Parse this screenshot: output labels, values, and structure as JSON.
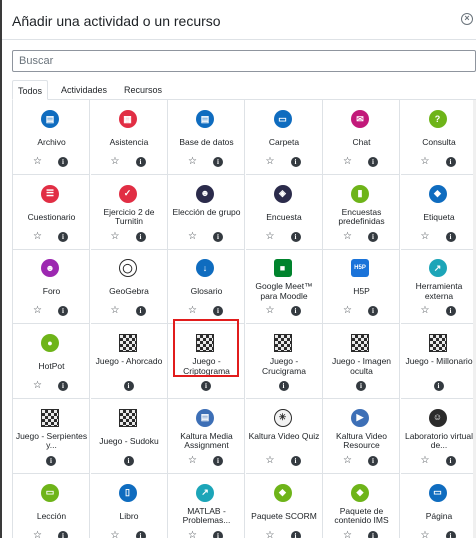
{
  "modal": {
    "title": "Añadir una actividad o un recurso",
    "close_label": "×"
  },
  "search": {
    "placeholder": "Buscar",
    "value": ""
  },
  "tabs": [
    {
      "label": "Todos",
      "active": true
    },
    {
      "label": "Actividades",
      "active": false
    },
    {
      "label": "Recursos",
      "active": false
    }
  ],
  "icons": {
    "star": "☆",
    "info": "i"
  },
  "items": [
    {
      "name": "Archivo",
      "icon": "file-icon",
      "color": "#0f6cbf",
      "glyph": "▤",
      "starred": true
    },
    {
      "name": "Asistencia",
      "icon": "attendance-icon",
      "color": "#e12e44",
      "glyph": "▦",
      "starred": true
    },
    {
      "name": "Base de datos",
      "icon": "database-icon",
      "color": "#0f6cbf",
      "glyph": "▤",
      "starred": true
    },
    {
      "name": "Carpeta",
      "icon": "folder-icon",
      "color": "#0f6cbf",
      "glyph": "▭",
      "starred": true
    },
    {
      "name": "Chat",
      "icon": "chat-icon",
      "color": "#c2197a",
      "glyph": "✉",
      "starred": true
    },
    {
      "name": "Consulta",
      "icon": "question-icon",
      "color": "#6eb419",
      "glyph": "?",
      "starred": true
    },
    {
      "name": "Cuestionario",
      "icon": "quiz-icon",
      "color": "#e12e44",
      "glyph": "☰",
      "starred": true
    },
    {
      "name": "Ejercicio 2 de Turnitin",
      "icon": "turnitin-icon",
      "color": "#e12e44",
      "glyph": "✓",
      "starred": true
    },
    {
      "name": "Elección de grupo",
      "icon": "group-choice-icon",
      "color": "#2b2b4b",
      "glyph": "☻",
      "starred": true
    },
    {
      "name": "Encuesta",
      "icon": "survey-icon",
      "color": "#2b2b4b",
      "glyph": "◈",
      "starred": true
    },
    {
      "name": "Encuestas predefinidas",
      "icon": "feedback-icon",
      "color": "#6eb419",
      "glyph": "▮",
      "starred": true
    },
    {
      "name": "Etiqueta",
      "icon": "label-icon",
      "color": "#0f6cbf",
      "glyph": "◆",
      "starred": true
    },
    {
      "name": "Foro",
      "icon": "forum-icon",
      "color": "#9c27b0",
      "glyph": "☻",
      "starred": true
    },
    {
      "name": "GeoGebra",
      "icon": "geogebra-icon",
      "color": "#ffffff",
      "glyph": "◯",
      "starred": true
    },
    {
      "name": "Glosario",
      "icon": "glossary-icon",
      "color": "#0f6cbf",
      "glyph": "↓",
      "starred": true
    },
    {
      "name": "Google Meet™ para Moodle",
      "icon": "google-meet-icon",
      "color": "#00832d",
      "glyph": "■",
      "starred": true
    },
    {
      "name": "H5P",
      "icon": "h5p-icon",
      "color": "#1a73d9",
      "glyph": "H5P",
      "starred": true
    },
    {
      "name": "Herramienta externa",
      "icon": "external-tool-icon",
      "color": "#1ca5b8",
      "glyph": "↗",
      "starred": true
    },
    {
      "name": "HotPot",
      "icon": "hotpot-icon",
      "color": "#6eb419",
      "glyph": "●",
      "starred": true
    },
    {
      "name": "Juego - Ahorcado",
      "icon": "game-hangman-icon",
      "color": "#2b2b2b",
      "glyph": "",
      "starred": false
    },
    {
      "name": "Juego - Criptograma",
      "icon": "game-cryptex-icon",
      "color": "#2b2b2b",
      "glyph": "",
      "starred": false
    },
    {
      "name": "Juego - Crucigrama",
      "icon": "game-crossword-icon",
      "color": "#2b2b2b",
      "glyph": "",
      "starred": false
    },
    {
      "name": "Juego - Imagen oculta",
      "icon": "game-hidden-picture-icon",
      "color": "#2b2b2b",
      "glyph": "",
      "starred": false
    },
    {
      "name": "Juego - Millonario",
      "icon": "game-millionaire-icon",
      "color": "#2b2b2b",
      "glyph": "",
      "starred": false
    },
    {
      "name": "Juego - Serpientes y...",
      "icon": "game-snakes-icon",
      "color": "#2b2b2b",
      "glyph": "",
      "starred": false
    },
    {
      "name": "Juego - Sudoku",
      "icon": "game-sudoku-icon",
      "color": "#2b2b2b",
      "glyph": "",
      "starred": false
    },
    {
      "name": "Kaltura Media Assignment",
      "icon": "kaltura-assignment-icon",
      "color": "#3d6fb6",
      "glyph": "▤",
      "starred": true
    },
    {
      "name": "Kaltura Video Quiz",
      "icon": "kaltura-quiz-icon",
      "color": "#f2f2f2",
      "glyph": "✳",
      "starred": true
    },
    {
      "name": "Kaltura Video Resource",
      "icon": "kaltura-video-icon",
      "color": "#3d6fb6",
      "glyph": "▶",
      "starred": true
    },
    {
      "name": "Laboratorio virtual de...",
      "icon": "virtual-lab-icon",
      "color": "#2b2b2b",
      "glyph": "☺",
      "starred": true
    },
    {
      "name": "Lección",
      "icon": "lesson-icon",
      "color": "#6eb419",
      "glyph": "▭",
      "starred": true
    },
    {
      "name": "Libro",
      "icon": "book-icon",
      "color": "#0f6cbf",
      "glyph": "▯",
      "starred": true
    },
    {
      "name": "MATLAB - Problemas...",
      "icon": "matlab-icon",
      "color": "#1ca5b8",
      "glyph": "↗",
      "starred": true
    },
    {
      "name": "Paquete SCORM",
      "icon": "scorm-icon",
      "color": "#6eb419",
      "glyph": "◆",
      "starred": true
    },
    {
      "name": "Paquete de contenido IMS",
      "icon": "ims-icon",
      "color": "#6eb419",
      "glyph": "◆",
      "starred": true
    },
    {
      "name": "Página",
      "icon": "page-icon",
      "color": "#0f6cbf",
      "glyph": "▭",
      "starred": true
    }
  ],
  "highlighted_item": "Juego - Criptograma",
  "colors": {
    "highlight_border": "#e11c1c",
    "border": "#dee2e6"
  }
}
